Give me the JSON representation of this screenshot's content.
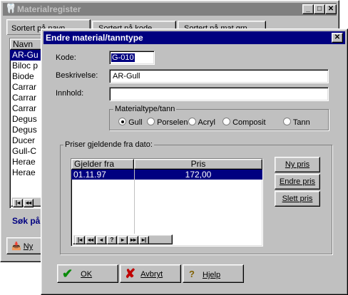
{
  "main_window": {
    "title": "Materialregister",
    "tabs": [
      "Sortert på navn",
      "Sortert på kode",
      "Sortert på mat.grp"
    ],
    "list_header": "Navn",
    "list_items": [
      "AR-Gu",
      "Biloc p",
      "Biode",
      "Carrar",
      "Carrar",
      "Carrar",
      "Degus",
      "Degus",
      "Ducer",
      "Gull-C",
      "Herae",
      "Herae"
    ],
    "search_label": "Søk på",
    "new_button": "Ny"
  },
  "dialog": {
    "title": "Endre material/tanntype",
    "kode_label": "Kode:",
    "kode_value": "G-010",
    "beskrivelse_label": "Beskrivelse:",
    "beskrivelse_value": "AR-Gull",
    "innhold_label": "Innhold:",
    "innhold_value": "",
    "materialtype_legend": "Materialtype/tann",
    "materialtype_options": [
      "Gull",
      "Porselen",
      "Acryl",
      "Composit",
      "Tann"
    ],
    "materialtype_selected": "Gull",
    "priser_legend": "Priser gjeldende fra dato:",
    "table_headers": [
      "Gjelder fra",
      "Pris"
    ],
    "table_rows": [
      {
        "gjelder_fra": "01.11.97",
        "pris": "172,00"
      }
    ],
    "ny_pris": "Ny pris",
    "endre_pris": "Endre pris",
    "slett_pris": "Slett pris",
    "ok": "OK",
    "avbryt": "Avbryt",
    "hjelp": "Hjelp"
  },
  "colors": {
    "titlebar_active": "#000080",
    "titlebar_inactive": "#808080",
    "face": "#c0c0c0",
    "selection": "#000080"
  }
}
